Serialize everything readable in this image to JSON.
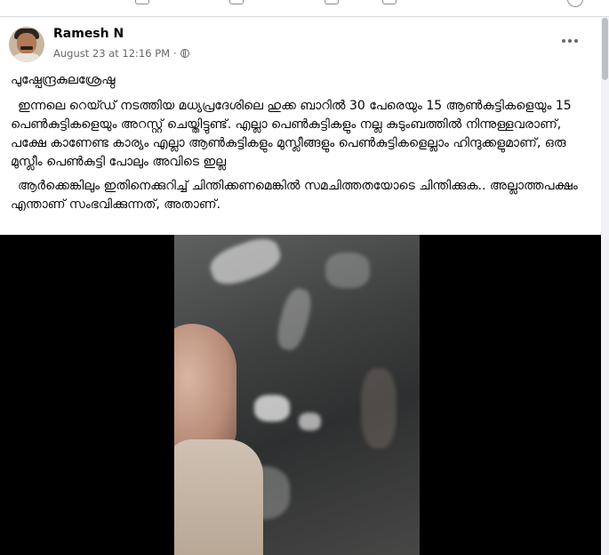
{
  "post": {
    "author": "Ramesh N",
    "timestamp": "August 23 at 12:16 PM",
    "separator": "·",
    "privacy_icon": "globe-icon",
    "more_icon": "more-options-icon",
    "title": "പുഷ്പേന്ദ്രകുലശ്രേഷ്ഠ",
    "paragraph_1": "ഇന്നലെ റെയ്ഡ് നടത്തിയ മധ്യപ്രദേശിലെ ഹുക്ക ബാറിൽ 30 പേരെയും 15 ആൺകുട്ടികളെയും 15 പെൺകുട്ടികളെയും അറസ്റ്റ് ചെയ്തിട്ടുണ്ട്.  എല്ലാ പെൺകുട്ടികളും നല്ല കുടുംബത്തിൽ നിന്നുള്ളവരാണ്, പക്ഷേ കാണേണ്ട കാര്യം എല്ലാ ആൺകുട്ടികളും മുസ്ലീങ്ങളും പെൺകുട്ടികളെല്ലാം ഹിന്ദുക്കളുമാണ്, ഒരു മുസ്ലീം പെൺകുട്ടി പോലും അവിടെ ഇല്ല",
    "paragraph_2": "ആർക്കെങ്കിലും ഇതിനെക്കുറിച്ച് ചിന്തിക്കണമെങ്കിൽ സമചിത്തതയോടെ ചിന്തിക്കുക.. അല്ലാത്തപക്ഷം എന്താണ് സംഭവിക്കുന്നത്, അതാണ്."
  },
  "colors": {
    "page_background": "#f0f2f5",
    "card_background": "#ffffff",
    "text_primary": "#050505",
    "text_secondary": "#65676b",
    "video_background": "#000000"
  }
}
